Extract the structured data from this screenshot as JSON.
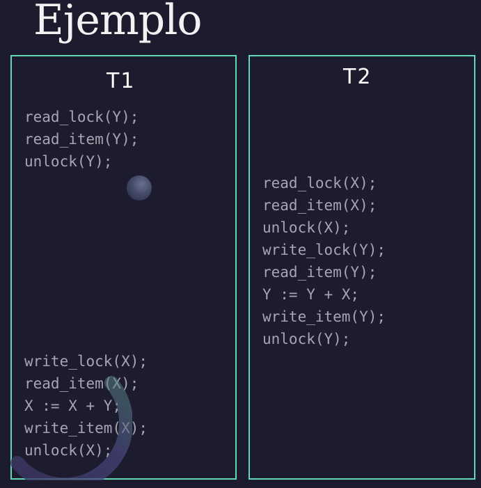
{
  "title": "Ejemplo",
  "transactions": [
    {
      "label": "T1",
      "block_a": [
        "read_lock(Y);",
        "read_item(Y);",
        "unlock(Y);"
      ],
      "block_b": [
        "write_lock(X);",
        "read_item(X);",
        "X := X + Y;",
        "write_item(X);",
        "unlock(X);"
      ]
    },
    {
      "label": "T2",
      "block": [
        "read_lock(X);",
        "read_item(X);",
        "unlock(X);",
        "write_lock(Y);",
        "read_item(Y);",
        "Y := Y + X;",
        "write_item(Y);",
        "unlock(Y);"
      ]
    }
  ],
  "colors": {
    "background": "#1c1c2e",
    "border": "#5fdcb4",
    "code_text": "#a6a6b0",
    "header_text": "#ffffff"
  }
}
